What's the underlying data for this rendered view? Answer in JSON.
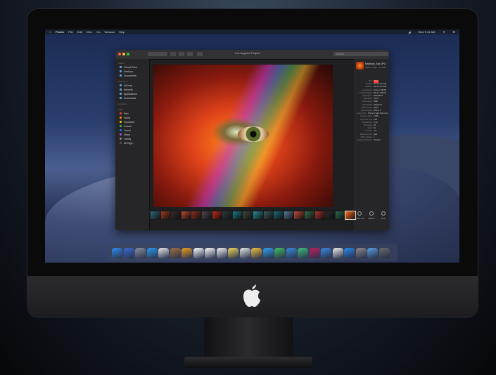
{
  "menubar": {
    "items": [
      "Finder",
      "File",
      "Edit",
      "View",
      "Go",
      "Window",
      "Help"
    ],
    "clock": "Wed 9:41 AM"
  },
  "window": {
    "title": "Los Angeles Project",
    "search_placeholder": "Search"
  },
  "sidebar": {
    "sections": [
      {
        "header": "iCloud",
        "items": [
          "iCloud Drive",
          "Desktop",
          "Documents"
        ]
      },
      {
        "header": "Favorites",
        "items": [
          "AirDrop",
          "Recents",
          "Applications",
          "Downloads"
        ]
      },
      {
        "header": "Locations",
        "items": []
      },
      {
        "header": "Tags",
        "items": [
          "Red",
          "Home",
          "Important",
          "School",
          "Travel",
          "Music",
          "Family",
          "All Tags..."
        ]
      }
    ],
    "tag_colors": [
      "#ff3b30",
      "#ff9500",
      "#ffcc00",
      "#34c759",
      "#007aff",
      "#af52de",
      "#8e8e93",
      "#555555"
    ]
  },
  "inspector": {
    "filename": "Rainbow_Eye.JPG",
    "subtitle": "JPEG image - 2.8 MB",
    "metadata": [
      {
        "k": "Tags",
        "v": "Red"
      },
      {
        "k": "Created",
        "v": "2/1/18, 9:14 AM"
      },
      {
        "k": "Modified",
        "v": "2/1/18, 9:14 AM"
      },
      {
        "k": "Last opened",
        "v": "Today, 2:18 PM"
      },
      {
        "k": "Content created",
        "v": "8/1/17, 4:05 PM"
      },
      {
        "k": "Dimensions",
        "v": "4032x3024"
      },
      {
        "k": "Resolution",
        "v": "72x72"
      },
      {
        "k": "Color space",
        "v": "RGB"
      },
      {
        "k": "Color profile",
        "v": "Display P3"
      },
      {
        "k": "Device make",
        "v": "Apple"
      },
      {
        "k": "Device model",
        "v": "iPhone X"
      },
      {
        "k": "Lens model",
        "v": "iPhone X back dual camera 4mm f/1.8"
      },
      {
        "k": "Aperture value",
        "v": "1.696"
      },
      {
        "k": "Exposure time",
        "v": "1/60"
      },
      {
        "k": "Focal length",
        "v": "4 mm"
      },
      {
        "k": "ISO speed",
        "v": "25"
      },
      {
        "k": "Flash",
        "v": "No"
      },
      {
        "k": "F number",
        "v": "1.8"
      },
      {
        "k": "Metering mode",
        "v": "Spot"
      },
      {
        "k": "White balance",
        "v": "0"
      },
      {
        "k": "Exposure Program",
        "v": "Program"
      }
    ],
    "actions": [
      "Rotate Left",
      "Markup",
      "More"
    ]
  },
  "filmstrip": {
    "colors": [
      "#2f6a7a",
      "#a03a20",
      "#3a2a2a",
      "#b84a2a",
      "#8a3020",
      "#4a4a50",
      "#c02a1a",
      "#2a3a3a",
      "#1a7a8a",
      "#3a4a3a",
      "#2a8a9a",
      "#3a5a5a",
      "#1a6a7a",
      "#5a7a9a",
      "#c04a3a",
      "#3a6a4a",
      "#b0302a",
      "#2a2a2a",
      "#2a6a4a",
      "#ff6a1a"
    ]
  },
  "dock": {
    "colors": [
      "#2d8cf0",
      "#3a6ad6",
      "#8a8fa0",
      "#2a9af0",
      "#e8e8e8",
      "#a07040",
      "#f0a020",
      "#ffffff",
      "#ffffff",
      "#f4f4f4",
      "#f0d860",
      "#e8e8e8",
      "#f0c040",
      "#30a0f0",
      "#40c060",
      "#3a8ae0",
      "#40c080",
      "#c02060",
      "#3a8ae0",
      "#f0f0f0",
      "#2a8af0",
      "#8a8a8a",
      "#5aa0e6",
      "#6a6a70"
    ]
  }
}
